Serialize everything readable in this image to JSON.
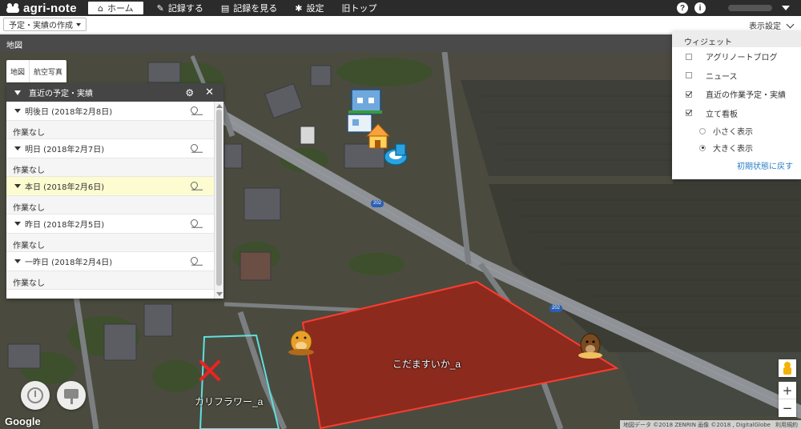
{
  "app": {
    "logo": "agri-note"
  },
  "nav": {
    "items": [
      {
        "label": "ホーム",
        "icon": "home-icon",
        "active": true
      },
      {
        "label": "記録する",
        "icon": "pencil-icon",
        "active": false
      },
      {
        "label": "記録を見る",
        "icon": "notebook-icon",
        "active": false
      },
      {
        "label": "設定",
        "icon": "gear-icon",
        "active": false
      },
      {
        "label": "旧トップ",
        "icon": "",
        "active": false
      }
    ],
    "help": "?",
    "info": "i"
  },
  "subbar": {
    "plan_button": "予定・実績の作成",
    "display_settings": "表示設定"
  },
  "section": {
    "title": "地図"
  },
  "map_tabs": [
    "地図",
    "航空写真"
  ],
  "panel": {
    "title": "直近の予定・実績",
    "days": [
      {
        "label": "明後日 (2018年2月8日)",
        "note": "作業なし",
        "today": false
      },
      {
        "label": "明日 (2018年2月7日)",
        "note": "作業なし",
        "today": false
      },
      {
        "label": "本日 (2018年2月6日)",
        "note": "作業なし",
        "today": true
      },
      {
        "label": "昨日 (2018年2月5日)",
        "note": "作業なし",
        "today": false
      },
      {
        "label": "一昨日 (2018年2月4日)",
        "note": "作業なし",
        "today": false
      }
    ]
  },
  "widget": {
    "title": "ウィジェット",
    "items": [
      {
        "label": "アグリノートブログ",
        "checked": false
      },
      {
        "label": "ニュース",
        "checked": false
      },
      {
        "label": "直近の作業予定・実績",
        "checked": true
      },
      {
        "label": "立て看板",
        "checked": true
      }
    ],
    "size_options": [
      {
        "label": "小さく表示",
        "selected": false
      },
      {
        "label": "大きく表示",
        "selected": true
      }
    ],
    "reset": "初期状態に戻す"
  },
  "map": {
    "field_labels": [
      "こだますいか_a",
      "カリフラワー_a"
    ],
    "route_numbers": [
      "202",
      "202"
    ],
    "zoom_in": "+",
    "zoom_out": "−",
    "google": "Google",
    "attribution": [
      "地図データ ©2018 ZENRIN 画像 ©2018 , DigitalGlobe",
      "利用規約"
    ],
    "colors": {
      "field_red": "#8c2a1e",
      "field_outline": "#ff3b2f",
      "field_cyan": "#5fe0e0",
      "road": "#8f9296"
    }
  }
}
